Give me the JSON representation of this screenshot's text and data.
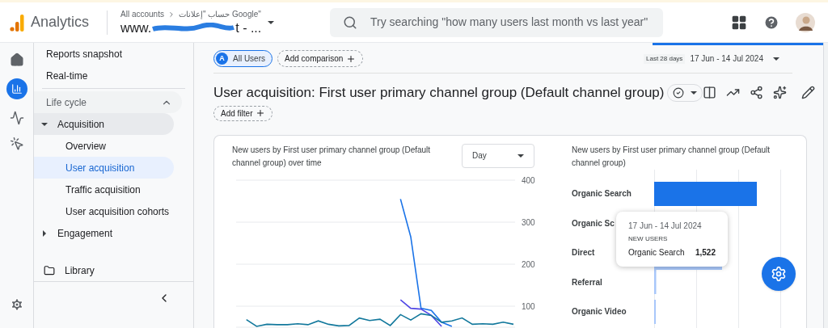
{
  "header": {
    "product": "Analytics",
    "breadcrumb": "All accounts",
    "account": "حساب \"إعلانات Google\"",
    "property_start": "www.",
    "property_end": "t - ...",
    "search_placeholder": "Try searching \"how many users last month vs last year\""
  },
  "sidebar": {
    "items": [
      {
        "kind": "link",
        "label": "Reports snapshot"
      },
      {
        "kind": "link",
        "label": "Real-time"
      },
      {
        "kind": "section",
        "label": "Life cycle",
        "expanded": true,
        "children": [
          {
            "label": "Acquisition",
            "expanded": true,
            "children": [
              {
                "label": "Overview",
                "selected": false
              },
              {
                "label": "User acquisition",
                "selected": true
              },
              {
                "label": "Traffic acquisition",
                "selected": false
              },
              {
                "label": "User acquisition cohorts",
                "selected": false
              }
            ]
          },
          {
            "label": "Engagement",
            "expanded": false
          }
        ]
      }
    ],
    "library": "Library"
  },
  "toolbar": {
    "comparisons": [
      {
        "badge": "A",
        "label": "All Users"
      }
    ],
    "add_comparison": "Add comparison",
    "range_label": "Last 28 days",
    "range": "17 Jun - 14 Jul 2024"
  },
  "report": {
    "title": "User acquisition: First user primary channel group (Default channel group)",
    "add_filter": "Add filter"
  },
  "line_card": {
    "title": "New users by First user primary channel group (Default channel group) over time",
    "granularity": "Day",
    "chart_data": {
      "type": "line",
      "grid": true,
      "ylim": [
        50,
        400
      ],
      "yticks": [
        100,
        200,
        300,
        400
      ],
      "series": [
        {
          "color": "#1a73e8",
          "values": [
            null,
            null,
            null,
            null,
            null,
            null,
            null,
            null,
            null,
            null,
            null,
            null,
            null,
            null,
            null,
            null,
            355,
            265,
            95,
            90,
            62,
            52,
            null,
            null,
            null,
            null,
            null,
            null
          ]
        },
        {
          "color": "#4f46e5",
          "values": [
            null,
            null,
            null,
            null,
            null,
            null,
            null,
            null,
            null,
            null,
            null,
            null,
            null,
            null,
            null,
            null,
            115,
            95,
            93,
            78,
            52,
            null,
            null,
            null,
            null,
            null,
            null,
            null
          ]
        },
        {
          "color": "#12789c",
          "values": [
            null,
            68,
            52,
            57,
            56,
            56,
            58,
            56,
            65,
            57,
            53,
            54,
            72,
            66,
            69,
            54,
            80,
            67,
            82,
            78,
            62,
            65,
            72,
            57,
            58,
            57,
            62,
            57
          ]
        }
      ]
    }
  },
  "bar_card": {
    "title": "New users by First user primary channel group (Default channel group)",
    "bars": [
      {
        "label": "Organic Search"
      },
      {
        "label": "Organic Sc"
      },
      {
        "label": "Direct"
      },
      {
        "label": "Referral"
      },
      {
        "label": "Organic Video"
      }
    ],
    "tooltip": {
      "date": "17 Jun - 14 Jul 2024",
      "metric": "NEW USERS",
      "channel": "Organic Search",
      "value": "1,522"
    }
  }
}
